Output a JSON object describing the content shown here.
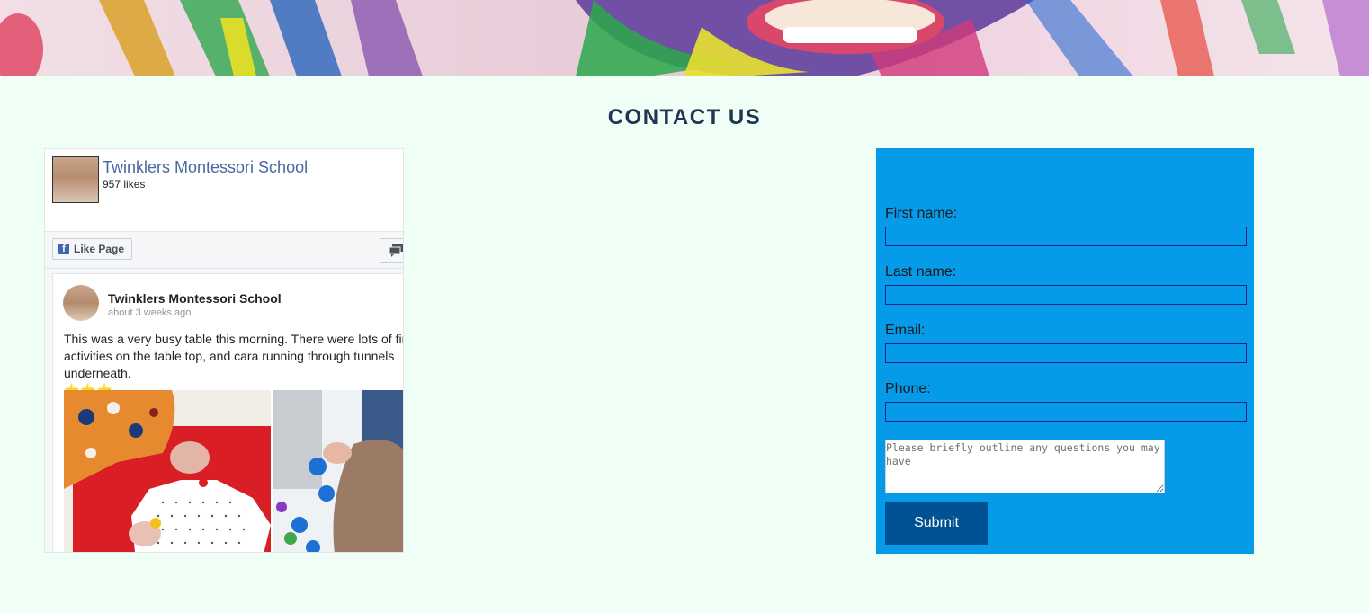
{
  "section": {
    "title": "CONTACT US"
  },
  "facebook": {
    "page_name": "Twinklers Montessori School",
    "likes": "957 likes",
    "like_button": "Like Page",
    "post": {
      "author": "Twinklers Montessori School",
      "time": "about 3 weeks ago",
      "text_lines": [
        "This was a very busy table this morning. There were lots of fine",
        "activities on the table top, and cara running through tunnels",
        "underneath."
      ],
      "stars": "⭐⭐⭐"
    }
  },
  "form": {
    "first_name_label": "First name:",
    "last_name_label": "Last name:",
    "email_label": "Email:",
    "phone_label": "Phone:",
    "questions_placeholder": "Please briefly outline any questions you may have",
    "submit_label": "Submit"
  },
  "colors": {
    "page_bg": "#effff6",
    "title": "#1e3553",
    "form_bg": "#059be8",
    "submit_bg": "#005294",
    "fb_link": "#4a67a1"
  }
}
